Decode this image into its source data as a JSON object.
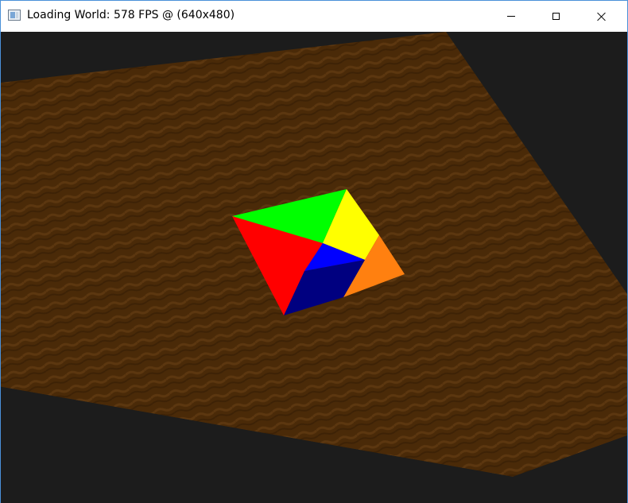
{
  "window": {
    "title": "Loading World: 578 FPS @ (640x480)",
    "icon": "application-window-icon",
    "controls": [
      "minimize-icon",
      "maximize-icon",
      "close-icon"
    ]
  },
  "scene": {
    "background_color": "#1c1c1c",
    "terrain_color": "#4a2a08",
    "terrain_stripe_color": "#5a360f",
    "object": "octahedron",
    "face_colors": {
      "green": "#00ff00",
      "red": "#ff0000",
      "yellow": "#ffff00",
      "blue": "#0000ff",
      "dark_blue": "#000080",
      "orange": "#ff8010",
      "brown": "#a05030"
    }
  }
}
